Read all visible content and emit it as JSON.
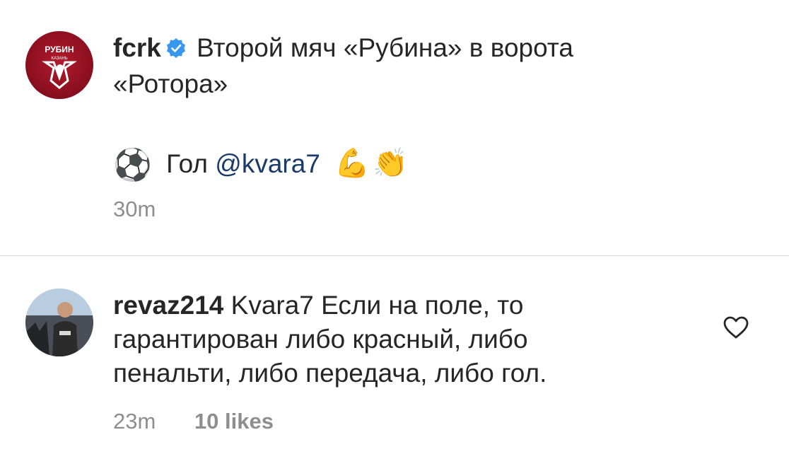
{
  "post": {
    "username": "fcrk",
    "caption_line1": "Второй мяч «Рубина» в ворота",
    "caption_line2": "«Ротора»",
    "goal_prefix": "Гол",
    "mention": "@kvara7",
    "emoji_ball": "⚽",
    "emoji_muscle": "💪",
    "emoji_clap": "👏",
    "timestamp": "30m",
    "avatar_logo_text": "РУБИН",
    "avatar_logo_subtext": "КАЗАНЬ",
    "avatar_icon": "rubin-club-logo",
    "verified_icon": "verified-badge-icon"
  },
  "comment": {
    "username": "revaz214",
    "text_line1": "Kvara7 Если на поле, то",
    "text_line2": "гарантирован либо красный, либо",
    "text_line3": "пенальти, либо передача, либо гол.",
    "timestamp": "23m",
    "likes": "10 likes",
    "like_icon": "heart-outline-icon"
  },
  "colors": {
    "verified": "#3897f0",
    "mention": "#1a3a6a",
    "meta": "#8e8e8e",
    "avatar_brand": "#9b1426"
  }
}
